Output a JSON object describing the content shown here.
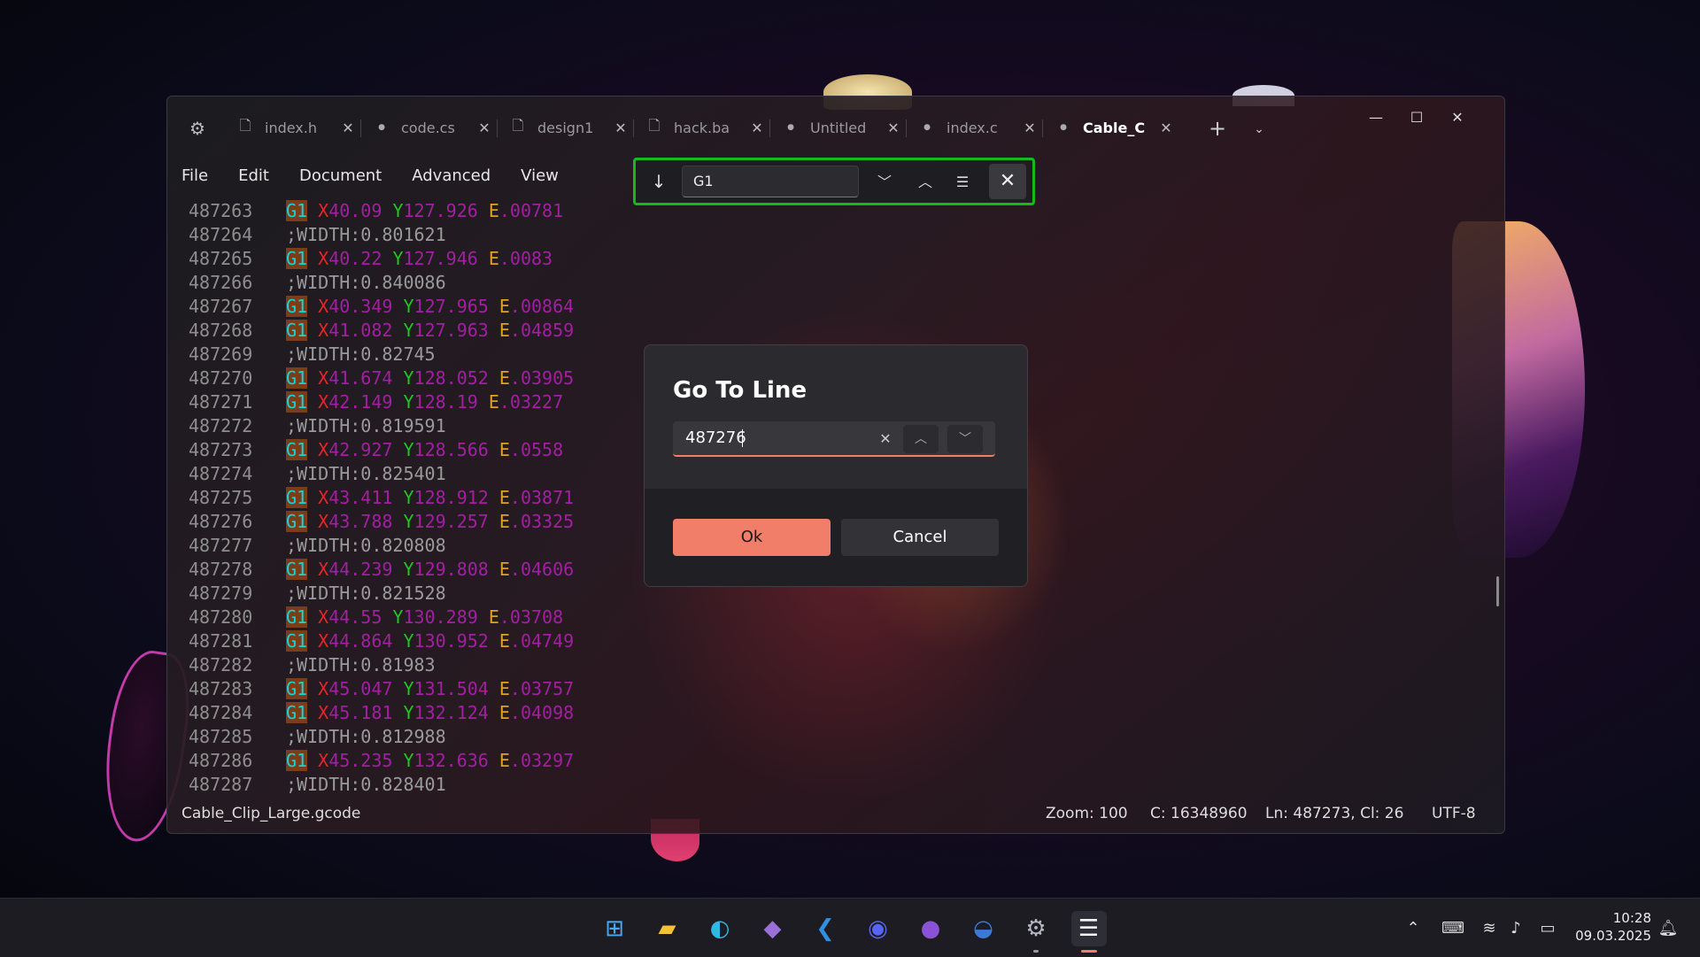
{
  "tabs": [
    {
      "label": "index.h",
      "icon": "file-icon"
    },
    {
      "label": "code.cs",
      "icon": "unsaved-dot-icon"
    },
    {
      "label": "design1",
      "icon": "file-icon"
    },
    {
      "label": "hack.ba",
      "icon": "file-icon"
    },
    {
      "label": "Untitled",
      "icon": "unsaved-dot-icon"
    },
    {
      "label": "index.c",
      "icon": "unsaved-dot-icon"
    },
    {
      "label": "Cable_C",
      "icon": "unsaved-dot-icon",
      "active": true
    }
  ],
  "menu": {
    "file": "File",
    "edit": "Edit",
    "document": "Document",
    "advanced": "Advanced",
    "view": "View"
  },
  "find": {
    "value": "G1"
  },
  "lines": [
    {
      "n": "487263",
      "t": "g",
      "x": "40.09",
      "y": "127.926",
      "e": ".00781"
    },
    {
      "n": "487264",
      "t": "c",
      "text": ";WIDTH:0.801621"
    },
    {
      "n": "487265",
      "t": "g",
      "x": "40.22",
      "y": "127.946",
      "e": ".0083"
    },
    {
      "n": "487266",
      "t": "c",
      "text": ";WIDTH:0.840086"
    },
    {
      "n": "487267",
      "t": "g",
      "x": "40.349",
      "y": "127.965",
      "e": ".00864"
    },
    {
      "n": "487268",
      "t": "g",
      "x": "41.082",
      "y": "127.963",
      "e": ".04859"
    },
    {
      "n": "487269",
      "t": "c",
      "text": ";WIDTH:0.82745"
    },
    {
      "n": "487270",
      "t": "g",
      "x": "41.674",
      "y": "128.052",
      "e": ".03905"
    },
    {
      "n": "487271",
      "t": "g",
      "x": "42.149",
      "y": "128.19",
      "e": ".03227"
    },
    {
      "n": "487272",
      "t": "c",
      "text": ";WIDTH:0.819591"
    },
    {
      "n": "487273",
      "t": "g",
      "x": "42.927",
      "y": "128.566",
      "e": ".0558"
    },
    {
      "n": "487274",
      "t": "c",
      "text": ";WIDTH:0.825401"
    },
    {
      "n": "487275",
      "t": "g",
      "x": "43.411",
      "y": "128.912",
      "e": ".03871"
    },
    {
      "n": "487276",
      "t": "g",
      "x": "43.788",
      "y": "129.257",
      "e": ".03325"
    },
    {
      "n": "487277",
      "t": "c",
      "text": ";WIDTH:0.820808"
    },
    {
      "n": "487278",
      "t": "g",
      "x": "44.239",
      "y": "129.808",
      "e": ".04606"
    },
    {
      "n": "487279",
      "t": "c",
      "text": ";WIDTH:0.821528"
    },
    {
      "n": "487280",
      "t": "g",
      "x": "44.55",
      "y": "130.289",
      "e": ".03708"
    },
    {
      "n": "487281",
      "t": "g",
      "x": "44.864",
      "y": "130.952",
      "e": ".04749"
    },
    {
      "n": "487282",
      "t": "c",
      "text": ";WIDTH:0.81983"
    },
    {
      "n": "487283",
      "t": "g",
      "x": "45.047",
      "y": "131.504",
      "e": ".03757"
    },
    {
      "n": "487284",
      "t": "g",
      "x": "45.181",
      "y": "132.124",
      "e": ".04098"
    },
    {
      "n": "487285",
      "t": "c",
      "text": ";WIDTH:0.812988"
    },
    {
      "n": "487286",
      "t": "g",
      "x": "45.235",
      "y": "132.636",
      "e": ".03297"
    },
    {
      "n": "487287",
      "t": "c",
      "text": ";WIDTH:0.828401"
    }
  ],
  "status": {
    "filename": "Cable_Clip_Large.gcode",
    "zoom": "Zoom: 100",
    "chars": "C: 16348960",
    "position": "Ln: 487273, Cl: 26",
    "encoding": "UTF-8"
  },
  "dialog": {
    "title": "Go To Line",
    "value": "487276",
    "ok": "Ok",
    "cancel": "Cancel"
  },
  "taskbar": {
    "apps": [
      "windows-start-icon",
      "file-explorer-icon",
      "edge-icon",
      "visual-studio-icon",
      "vscode-icon",
      "discord-icon",
      "github-icon",
      "thunderbird-icon",
      "settings-icon",
      "notepad-icon"
    ],
    "time": "10:28",
    "date": "09.03.2025"
  },
  "colors": {
    "accent": "#f07e68",
    "find_border": "#18b818",
    "g_code_bg": "#7a3d1a"
  }
}
